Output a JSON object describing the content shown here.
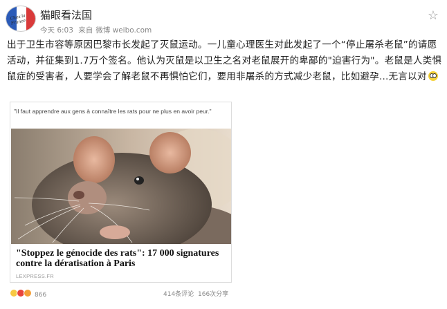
{
  "post": {
    "author": "猫眼看法国",
    "time": "今天 6:03",
    "source_prefix": "来自",
    "source": "微博 weibo.com",
    "content": "出于卫生市容等原因巴黎市长发起了灭鼠运动。一儿童心理医生对此发起了一个“停止屠杀老鼠”的请愿活动，并征集到1.7万个签名。他认为灭鼠是以卫生之名对老鼠展开的卑鄙的\"迫害行为\"。老鼠是人类惧鼠症的受害者，人要学会了解老鼠不再惧怕它们，要用非屠杀的方式减少老鼠，比如避孕...无言以对"
  },
  "avatar": {
    "flag_text": "Chez la France"
  },
  "card": {
    "quote": "\"Il faut apprendre aux gens à connaître les rats pour ne plus en avoir peur.\"",
    "headline": "\"Stoppez le génocide des rats\": 17 000 signatures contre la dératisation à Paris",
    "source": "LEXPRESS.FR"
  },
  "stats": {
    "reactions_count": "866",
    "comments": "414条评论",
    "reposts": "166次分享"
  },
  "icons": {
    "favorite": "star-icon",
    "emoji": "scared-face-icon"
  }
}
